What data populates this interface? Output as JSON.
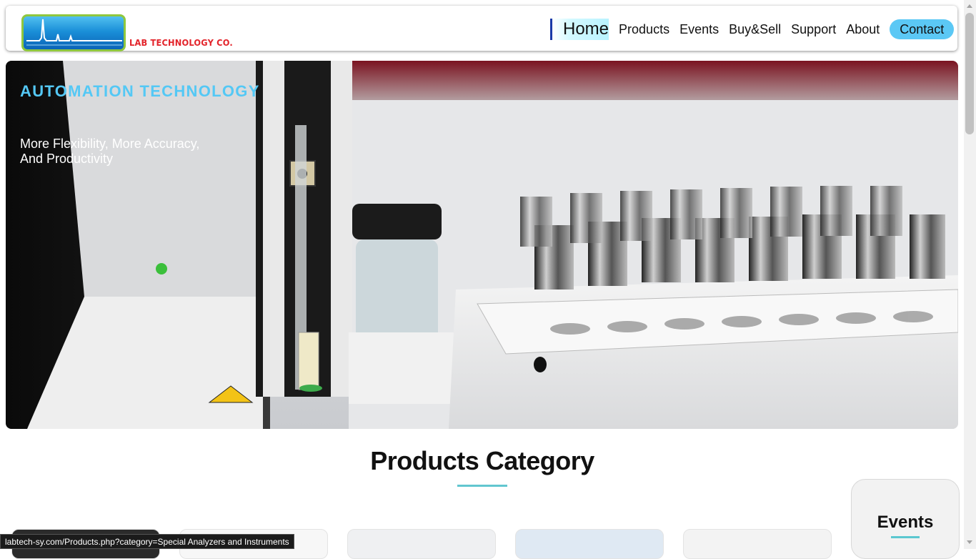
{
  "brand": {
    "logo_text": "LAB TECHNOLOGY CO.",
    "accent_colors": {
      "logo_red": "#e3242b",
      "logo_green": "#8fc73e",
      "nav_highlight": "#5bc8f5"
    }
  },
  "nav": {
    "items": [
      "Home",
      "Products",
      "Events",
      "Buy&Sell",
      "Support",
      "About"
    ],
    "contact": "Contact",
    "active": "Home"
  },
  "hero": {
    "title": "AUTOMATION TECHNOLOGY",
    "subtitle_line1": "More Flexibility, More Accuracy,",
    "subtitle_line2": "And Productivity"
  },
  "products": {
    "title": "Products Category"
  },
  "events": {
    "title": "Events"
  },
  "status_bar": {
    "url": "labtech-sy.com/Products.php?category=Special Analyzers and Instruments"
  }
}
